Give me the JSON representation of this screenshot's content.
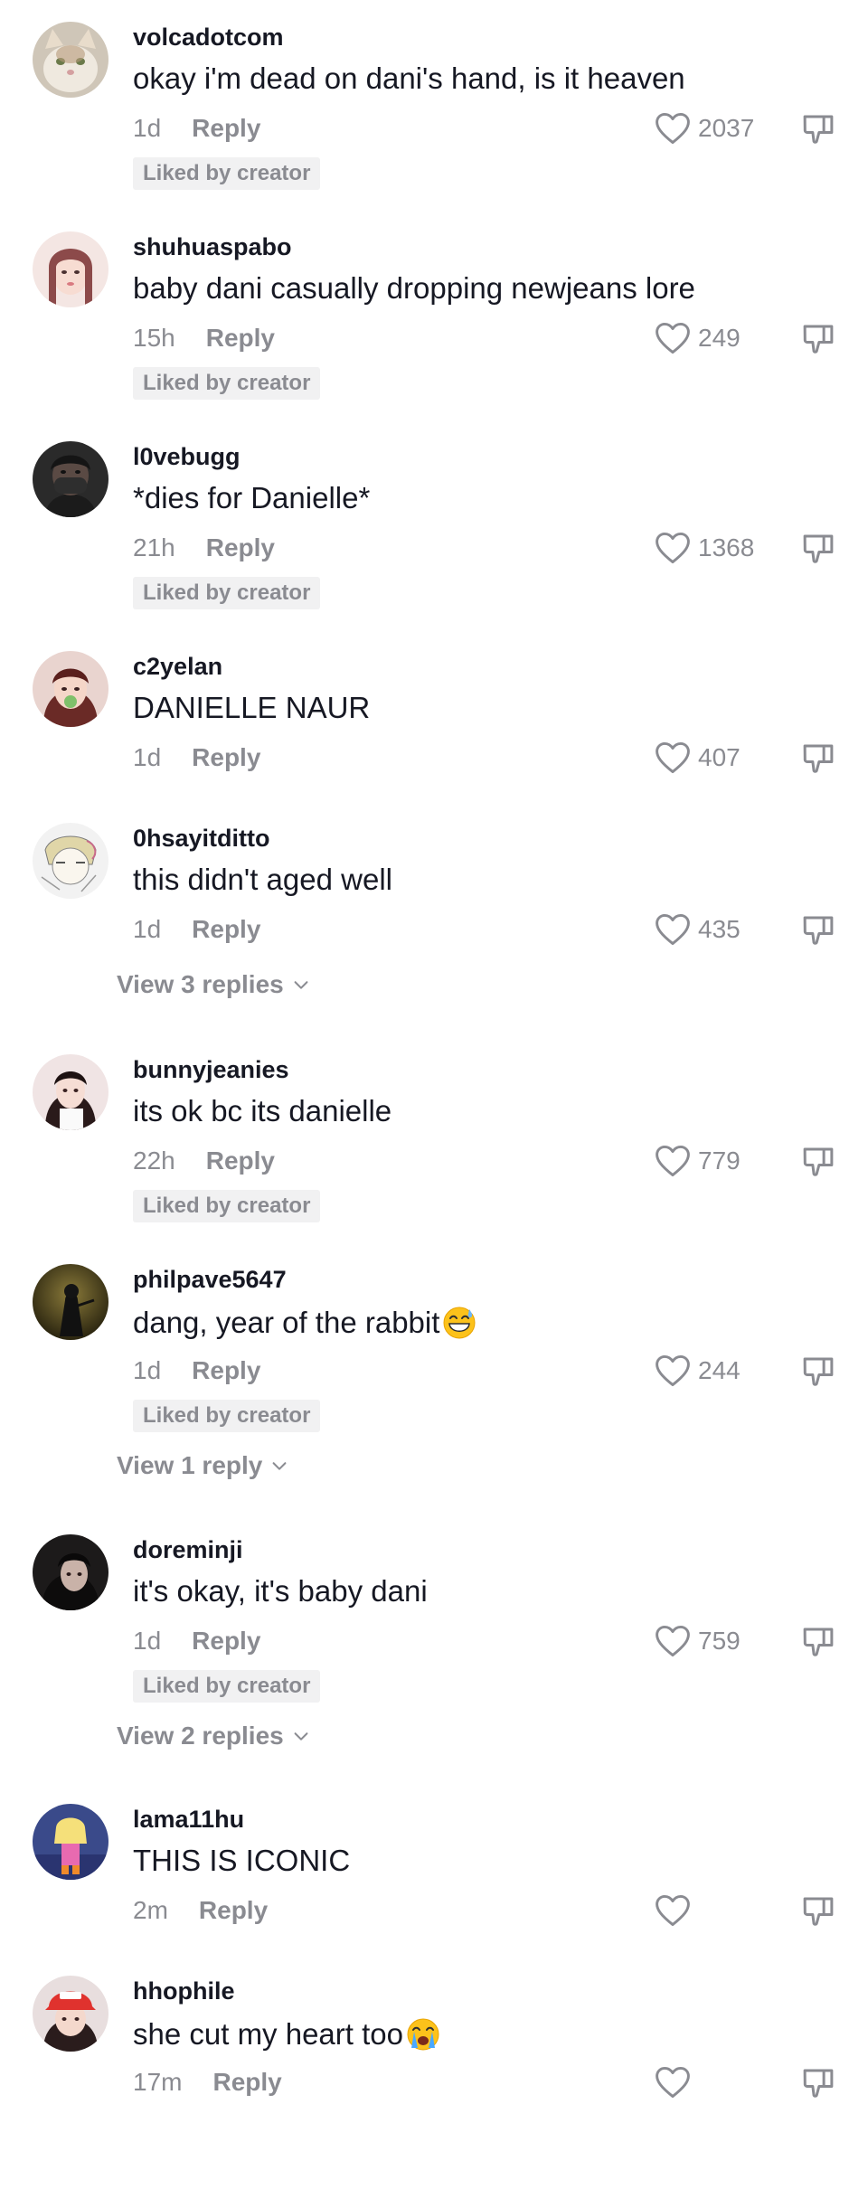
{
  "comments": [
    {
      "username": "volcadotcom",
      "text": "okay i'm dead on dani's hand, is it heaven",
      "time": "1d",
      "reply_label": "Reply",
      "likes": "2037",
      "badge": "Liked by creator",
      "avatar": "cat-avatar"
    },
    {
      "username": "shuhuaspabo",
      "text": "baby dani casually dropping newjeans lore",
      "time": "15h",
      "reply_label": "Reply",
      "likes": "249",
      "badge": "Liked by creator",
      "avatar": "woman-avatar"
    },
    {
      "username": "l0vebugg",
      "text": "*dies for Danielle*",
      "time": "21h",
      "reply_label": "Reply",
      "likes": "1368",
      "badge": "Liked by creator",
      "avatar": "masked-person-avatar"
    },
    {
      "username": "c2yelan",
      "text": "DANIELLE NAUR",
      "time": "1d",
      "reply_label": "Reply",
      "likes": "407",
      "avatar": "girl-avatar"
    },
    {
      "username": "0hsayitditto",
      "text": "this didn't aged well",
      "time": "1d",
      "reply_label": "Reply",
      "likes": "435",
      "avatar": "sketch-avatar",
      "view_replies": "View 3 replies"
    },
    {
      "username": "bunnyjeanies",
      "text": "its ok bc its danielle",
      "time": "22h",
      "reply_label": "Reply",
      "likes": "779",
      "badge": "Liked by creator",
      "avatar": "girl-avatar"
    },
    {
      "username": "philpave5647",
      "text": "dang, year of the rabbit",
      "emoji": "grinning-sweat-emoji",
      "time": "1d",
      "reply_label": "Reply",
      "likes": "244",
      "badge": "Liked by creator",
      "avatar": "dark-figure-avatar",
      "view_replies": "View 1 reply"
    },
    {
      "username": "doreminji",
      "text": "it's okay, it's baby dani",
      "time": "1d",
      "reply_label": "Reply",
      "likes": "759",
      "badge": "Liked by creator",
      "avatar": "dark-portrait-avatar",
      "view_replies": "View 2 replies"
    },
    {
      "username": "lama11hu",
      "text": "THIS IS ICONIC",
      "time": "2m",
      "reply_label": "Reply",
      "likes": "",
      "avatar": "cartoon-avatar"
    },
    {
      "username": "hhophile",
      "text": "she cut my heart too",
      "emoji": "loudly-crying-emoji",
      "time": "17m",
      "reply_label": "Reply",
      "likes": "",
      "avatar": "red-cap-avatar"
    }
  ],
  "colors": {
    "text_primary": "#161823",
    "text_secondary": "#8a8b91",
    "badge_background": "#f1f1f2"
  },
  "icons": {
    "like": "heart-outline-icon",
    "dislike": "thumbs-down-icon",
    "expand": "chevron-down-icon"
  }
}
